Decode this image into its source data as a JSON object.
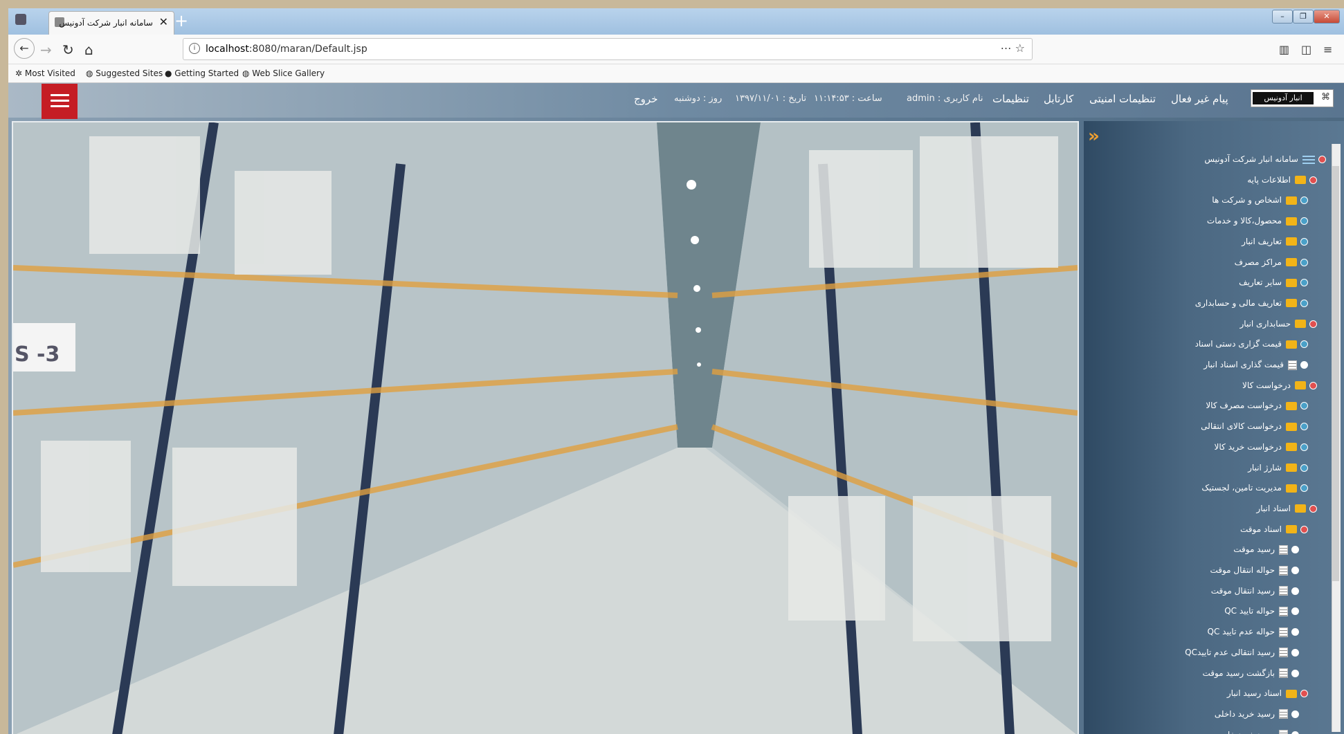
{
  "browser": {
    "tab_title": "سامانه انبار شرکت آدونیس",
    "tab_close": "✕",
    "new_tab": "+",
    "url_host": "localhost",
    "url_path": ":8080/maran/Default.jsp",
    "url_actions": "⋯  ☆",
    "bookmarks": [
      "Most Visited",
      "Suggested Sites",
      "Getting Started",
      "Web Slice Gallery"
    ]
  },
  "header": {
    "logo_text": "انبار آدونیس",
    "nav": [
      "پیام غیر فعال",
      "تنظیمات امنیتی",
      "کارتابل",
      "تنظیمات"
    ],
    "username": "نام کاربری : admin",
    "time": "ساعت : ۱۱:۱۴:۵۳",
    "date": "تاریخ : ۱۳۹۷/۱۱/۰۱",
    "day": "روز : دوشنبه",
    "logout": "خروج"
  },
  "tree": [
    {
      "label": "سامانه انبار شرکت آدونیس",
      "level": 0,
      "toggle": "minus",
      "icon": "root"
    },
    {
      "label": "اطلاعات پایه",
      "level": 1,
      "toggle": "minus",
      "icon": "folder"
    },
    {
      "label": "اشخاص و شرکت ها",
      "level": 2,
      "toggle": "plus",
      "icon": "folder"
    },
    {
      "label": "محصول،کالا و خدمات",
      "level": 2,
      "toggle": "plus",
      "icon": "folder"
    },
    {
      "label": "تعاریف انبار",
      "level": 2,
      "toggle": "plus",
      "icon": "folder"
    },
    {
      "label": "مراکز مصرف",
      "level": 2,
      "toggle": "plus",
      "icon": "folder"
    },
    {
      "label": "سایر تعاریف",
      "level": 2,
      "toggle": "plus",
      "icon": "folder"
    },
    {
      "label": "تعاریف مالی و حسابداری",
      "level": 2,
      "toggle": "plus",
      "icon": "folder"
    },
    {
      "label": "حسابداری انبار",
      "level": 1,
      "toggle": "minus",
      "icon": "folder"
    },
    {
      "label": "قیمت گزاری دستی اسناد",
      "level": 2,
      "toggle": "plus",
      "icon": "folder"
    },
    {
      "label": "قیمت گذاری اسناد انبار",
      "level": 2,
      "toggle": "dot",
      "icon": "doc"
    },
    {
      "label": "درخواست کالا",
      "level": 1,
      "toggle": "minus",
      "icon": "folder"
    },
    {
      "label": "درخواست مصرف کالا",
      "level": 2,
      "toggle": "plus",
      "icon": "folder"
    },
    {
      "label": "درخواست کالای انتقالی",
      "level": 2,
      "toggle": "plus",
      "icon": "folder"
    },
    {
      "label": "درخواست خرید کالا",
      "level": 2,
      "toggle": "plus",
      "icon": "folder"
    },
    {
      "label": "شارژ انبار",
      "level": 2,
      "toggle": "plus",
      "icon": "folder"
    },
    {
      "label": "مدیریت تامین، لجستیک",
      "level": 2,
      "toggle": "plus",
      "icon": "folder"
    },
    {
      "label": "اسناد انبار",
      "level": 1,
      "toggle": "minus",
      "icon": "folder"
    },
    {
      "label": "اسناد موقت",
      "level": 2,
      "toggle": "minus",
      "icon": "folder"
    },
    {
      "label": "رسید موقت",
      "level": 3,
      "toggle": "dot",
      "icon": "doc"
    },
    {
      "label": "حواله انتقال موقت",
      "level": 3,
      "toggle": "dot",
      "icon": "doc"
    },
    {
      "label": "رسید انتقال موقت",
      "level": 3,
      "toggle": "dot",
      "icon": "doc"
    },
    {
      "label": "حواله تایید QC",
      "level": 3,
      "toggle": "dot",
      "icon": "doc"
    },
    {
      "label": "حواله عدم تایید QC",
      "level": 3,
      "toggle": "dot",
      "icon": "doc"
    },
    {
      "label": "رسید انتقالی عدم تاییدQC",
      "level": 3,
      "toggle": "dot",
      "icon": "doc"
    },
    {
      "label": "بازگشت رسید موقت",
      "level": 3,
      "toggle": "dot",
      "icon": "doc"
    },
    {
      "label": "اسناد رسید انبار",
      "level": 2,
      "toggle": "minus",
      "icon": "folder"
    },
    {
      "label": "رسید خرید داخلی",
      "level": 3,
      "toggle": "dot",
      "icon": "doc"
    },
    {
      "label": "رسید خرید خارجی",
      "level": 3,
      "toggle": "dot",
      "icon": "doc"
    }
  ],
  "hero": {
    "rack_label": "S -3"
  }
}
